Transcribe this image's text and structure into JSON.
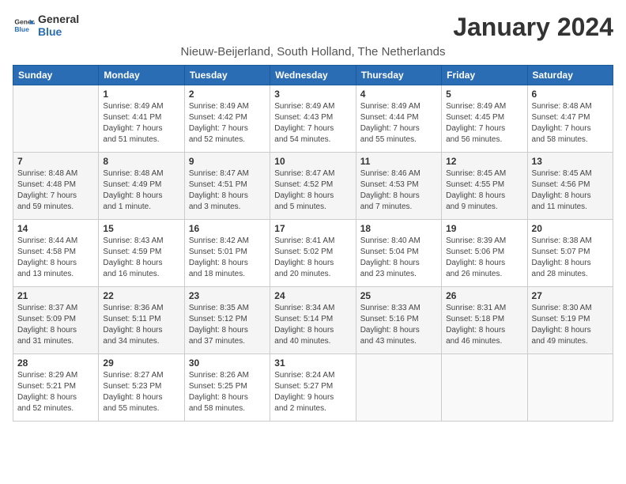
{
  "logo": {
    "line1": "General",
    "line2": "Blue"
  },
  "title": "January 2024",
  "subtitle": "Nieuw-Beijerland, South Holland, The Netherlands",
  "headers": [
    "Sunday",
    "Monday",
    "Tuesday",
    "Wednesday",
    "Thursday",
    "Friday",
    "Saturday"
  ],
  "weeks": [
    [
      {
        "day": "",
        "info": ""
      },
      {
        "day": "1",
        "info": "Sunrise: 8:49 AM\nSunset: 4:41 PM\nDaylight: 7 hours\nand 51 minutes."
      },
      {
        "day": "2",
        "info": "Sunrise: 8:49 AM\nSunset: 4:42 PM\nDaylight: 7 hours\nand 52 minutes."
      },
      {
        "day": "3",
        "info": "Sunrise: 8:49 AM\nSunset: 4:43 PM\nDaylight: 7 hours\nand 54 minutes."
      },
      {
        "day": "4",
        "info": "Sunrise: 8:49 AM\nSunset: 4:44 PM\nDaylight: 7 hours\nand 55 minutes."
      },
      {
        "day": "5",
        "info": "Sunrise: 8:49 AM\nSunset: 4:45 PM\nDaylight: 7 hours\nand 56 minutes."
      },
      {
        "day": "6",
        "info": "Sunrise: 8:48 AM\nSunset: 4:47 PM\nDaylight: 7 hours\nand 58 minutes."
      }
    ],
    [
      {
        "day": "7",
        "info": "Sunrise: 8:48 AM\nSunset: 4:48 PM\nDaylight: 7 hours\nand 59 minutes."
      },
      {
        "day": "8",
        "info": "Sunrise: 8:48 AM\nSunset: 4:49 PM\nDaylight: 8 hours\nand 1 minute."
      },
      {
        "day": "9",
        "info": "Sunrise: 8:47 AM\nSunset: 4:51 PM\nDaylight: 8 hours\nand 3 minutes."
      },
      {
        "day": "10",
        "info": "Sunrise: 8:47 AM\nSunset: 4:52 PM\nDaylight: 8 hours\nand 5 minutes."
      },
      {
        "day": "11",
        "info": "Sunrise: 8:46 AM\nSunset: 4:53 PM\nDaylight: 8 hours\nand 7 minutes."
      },
      {
        "day": "12",
        "info": "Sunrise: 8:45 AM\nSunset: 4:55 PM\nDaylight: 8 hours\nand 9 minutes."
      },
      {
        "day": "13",
        "info": "Sunrise: 8:45 AM\nSunset: 4:56 PM\nDaylight: 8 hours\nand 11 minutes."
      }
    ],
    [
      {
        "day": "14",
        "info": "Sunrise: 8:44 AM\nSunset: 4:58 PM\nDaylight: 8 hours\nand 13 minutes."
      },
      {
        "day": "15",
        "info": "Sunrise: 8:43 AM\nSunset: 4:59 PM\nDaylight: 8 hours\nand 16 minutes."
      },
      {
        "day": "16",
        "info": "Sunrise: 8:42 AM\nSunset: 5:01 PM\nDaylight: 8 hours\nand 18 minutes."
      },
      {
        "day": "17",
        "info": "Sunrise: 8:41 AM\nSunset: 5:02 PM\nDaylight: 8 hours\nand 20 minutes."
      },
      {
        "day": "18",
        "info": "Sunrise: 8:40 AM\nSunset: 5:04 PM\nDaylight: 8 hours\nand 23 minutes."
      },
      {
        "day": "19",
        "info": "Sunrise: 8:39 AM\nSunset: 5:06 PM\nDaylight: 8 hours\nand 26 minutes."
      },
      {
        "day": "20",
        "info": "Sunrise: 8:38 AM\nSunset: 5:07 PM\nDaylight: 8 hours\nand 28 minutes."
      }
    ],
    [
      {
        "day": "21",
        "info": "Sunrise: 8:37 AM\nSunset: 5:09 PM\nDaylight: 8 hours\nand 31 minutes."
      },
      {
        "day": "22",
        "info": "Sunrise: 8:36 AM\nSunset: 5:11 PM\nDaylight: 8 hours\nand 34 minutes."
      },
      {
        "day": "23",
        "info": "Sunrise: 8:35 AM\nSunset: 5:12 PM\nDaylight: 8 hours\nand 37 minutes."
      },
      {
        "day": "24",
        "info": "Sunrise: 8:34 AM\nSunset: 5:14 PM\nDaylight: 8 hours\nand 40 minutes."
      },
      {
        "day": "25",
        "info": "Sunrise: 8:33 AM\nSunset: 5:16 PM\nDaylight: 8 hours\nand 43 minutes."
      },
      {
        "day": "26",
        "info": "Sunrise: 8:31 AM\nSunset: 5:18 PM\nDaylight: 8 hours\nand 46 minutes."
      },
      {
        "day": "27",
        "info": "Sunrise: 8:30 AM\nSunset: 5:19 PM\nDaylight: 8 hours\nand 49 minutes."
      }
    ],
    [
      {
        "day": "28",
        "info": "Sunrise: 8:29 AM\nSunset: 5:21 PM\nDaylight: 8 hours\nand 52 minutes."
      },
      {
        "day": "29",
        "info": "Sunrise: 8:27 AM\nSunset: 5:23 PM\nDaylight: 8 hours\nand 55 minutes."
      },
      {
        "day": "30",
        "info": "Sunrise: 8:26 AM\nSunset: 5:25 PM\nDaylight: 8 hours\nand 58 minutes."
      },
      {
        "day": "31",
        "info": "Sunrise: 8:24 AM\nSunset: 5:27 PM\nDaylight: 9 hours\nand 2 minutes."
      },
      {
        "day": "",
        "info": ""
      },
      {
        "day": "",
        "info": ""
      },
      {
        "day": "",
        "info": ""
      }
    ]
  ]
}
